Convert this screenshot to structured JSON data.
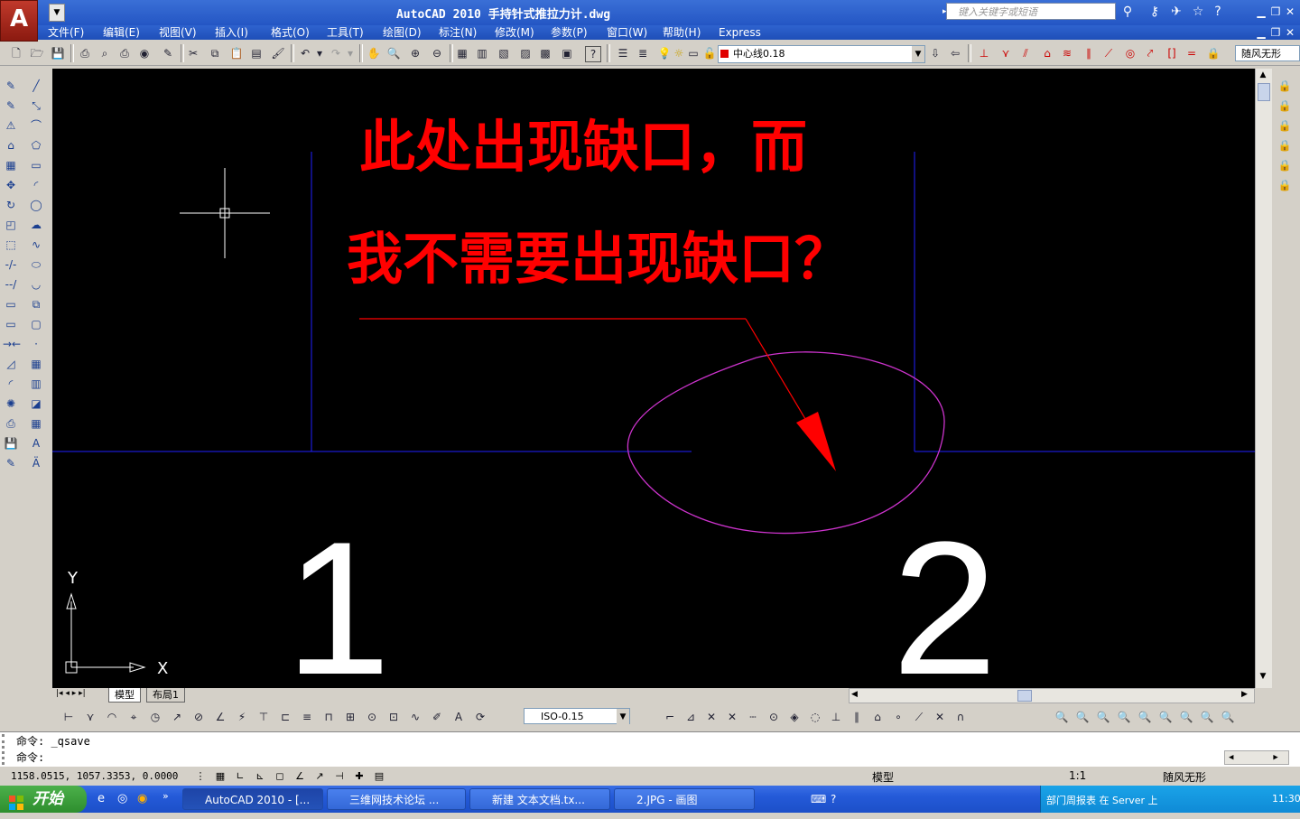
{
  "window": {
    "app_logo": "A",
    "title": "AutoCAD 2010  手持针式推拉力计.dwg",
    "search_placeholder": "键入关键字或短语"
  },
  "menu": [
    "文件(F)",
    "编辑(E)",
    "视图(V)",
    "插入(I)",
    "格式(O)",
    "工具(T)",
    "绘图(D)",
    "标注(N)",
    "修改(M)",
    "参数(P)",
    "窗口(W)",
    "帮助(H)",
    "Express"
  ],
  "layer": {
    "current": "中心线0.18",
    "color": "#e00000",
    "linetype": "随风无形"
  },
  "drawing": {
    "annotation_line1": "此处出现缺口，而",
    "annotation_line2": "我不需要出现缺口？",
    "label_left": "1",
    "label_right": "2",
    "axis_y": "Y",
    "axis_x": "X",
    "colors": {
      "background": "#000000",
      "annotation": "#ff0000",
      "lines": "#0000ff",
      "circle": "#cc33cc",
      "labels": "#ffffff"
    }
  },
  "layout_tabs": [
    "模型",
    "布局1"
  ],
  "dimstyle": "ISO-0.15",
  "command": {
    "line1": "命令:  _qsave",
    "line2": "命令:"
  },
  "status": {
    "coords": "1158.0515, 1057.3353, 0.0000",
    "model_label": "模型",
    "scale": "1:1",
    "workspace": "随风无形"
  },
  "taskbar": {
    "start": "开始",
    "tasks": [
      "AutoCAD 2010 - [...",
      "三维网技术论坛 ...",
      "新建 文本文档.tx...",
      "2.JPG - 画图"
    ],
    "tray_text": "部门周报表 在 Server 上",
    "clock": "11:30"
  }
}
